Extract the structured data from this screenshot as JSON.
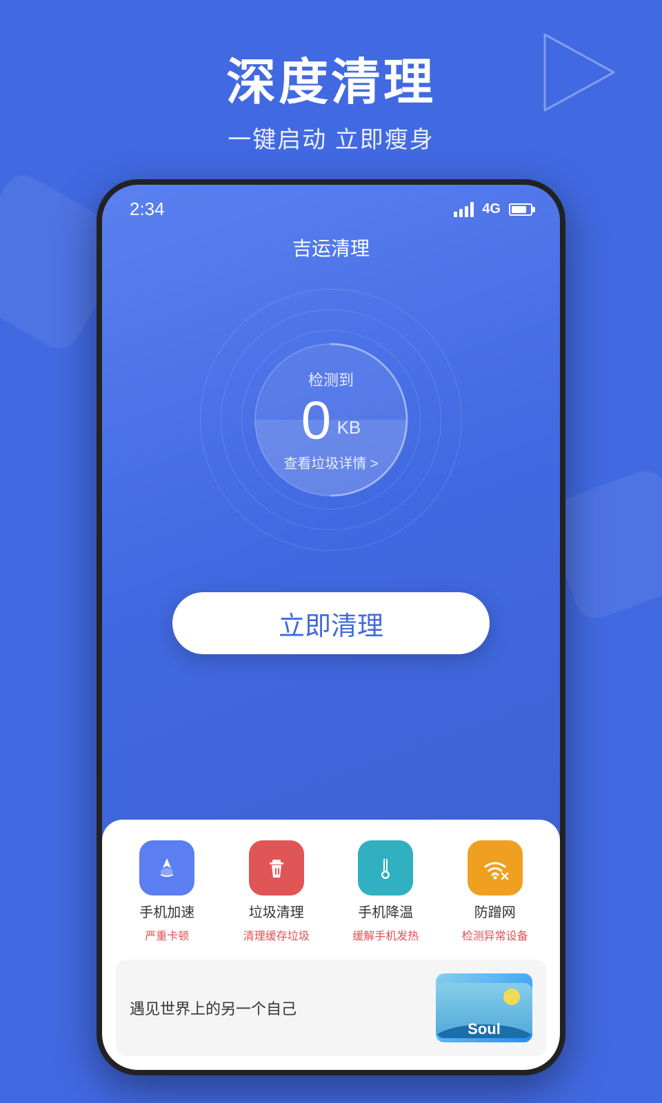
{
  "background_color": "#4169e1",
  "header": {
    "title": "深度清理",
    "subtitle": "一键启动 立即瘦身"
  },
  "phone": {
    "status_bar": {
      "time": "2:34",
      "signal": "4G"
    },
    "app_title": "吉运清理",
    "gauge": {
      "label": "检测到",
      "value": "0",
      "unit": "KB",
      "detail": "查看垃圾详情 >"
    },
    "clean_button": "立即清理",
    "features": [
      {
        "name": "手机加速",
        "desc": "严重卡顿",
        "desc_color": "#e05050",
        "icon_bg": "#5b7ff0",
        "icon": "🚀"
      },
      {
        "name": "垃圾清理",
        "desc": "清理缓存垃圾",
        "desc_color": "#e05050",
        "icon_bg": "#e05555",
        "icon": "🧹"
      },
      {
        "name": "手机降温",
        "desc": "缓解手机发热",
        "desc_color": "#e05050",
        "icon_bg": "#30b0c0",
        "icon": "🌡"
      },
      {
        "name": "防蹭网",
        "desc": "检测异常设备",
        "desc_color": "#e05050",
        "icon_bg": "#f0a020",
        "icon": "📶"
      }
    ],
    "ad": {
      "text": "遇见世界上的另一个自己",
      "image_label": "Soul"
    }
  }
}
